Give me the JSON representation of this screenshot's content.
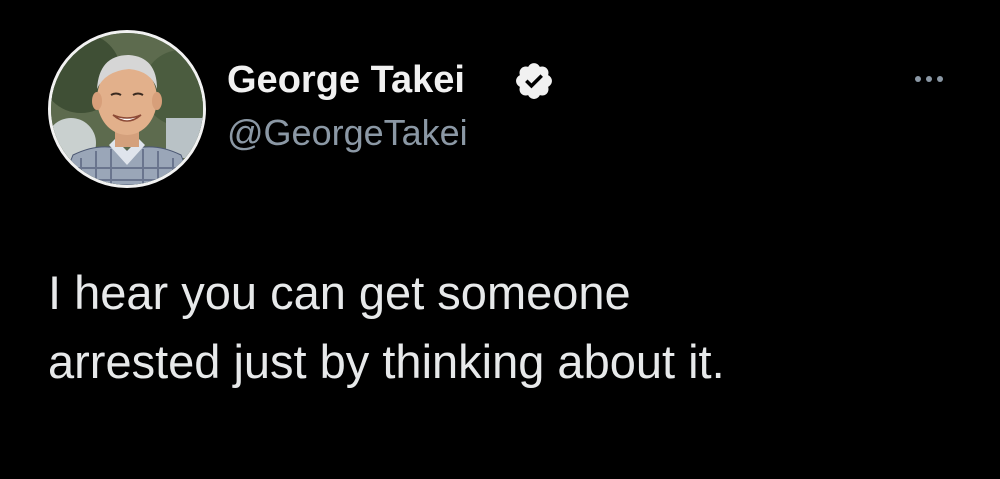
{
  "author": {
    "display_name": "George Takei",
    "handle": "@GeorgeTakei",
    "verified": true,
    "avatar_icon": "profile-photo-avatar"
  },
  "menu": {
    "icon": "more-options-icon"
  },
  "tweet": {
    "lines": [
      "I hear you can get someone",
      "arrested just by thinking about it."
    ]
  },
  "colors": {
    "background": "#000000",
    "name": "#f1f1f1",
    "handle": "#8b98a5",
    "text": "#e7e9ea",
    "verified_badge": "#f1f1f1"
  }
}
